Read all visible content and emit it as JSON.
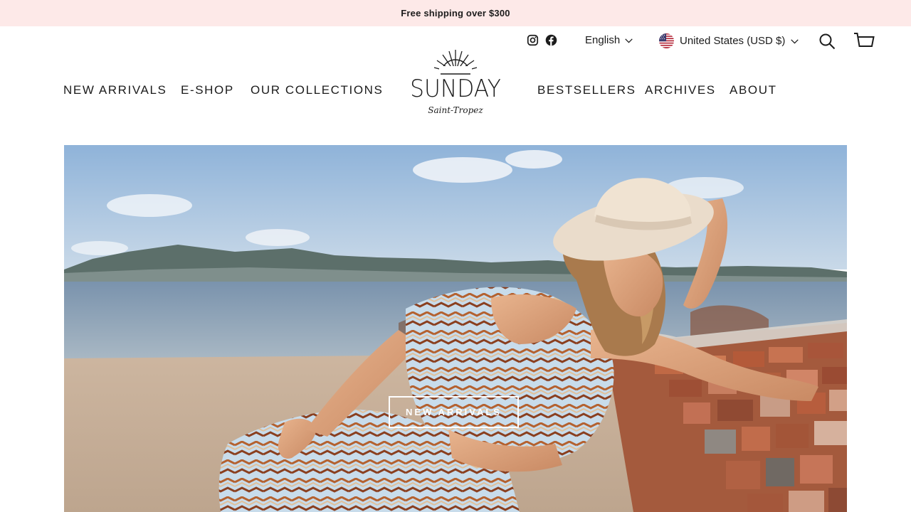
{
  "announcement": {
    "text": "Free shipping over $300"
  },
  "utility": {
    "language": "English",
    "country": "United States (USD $)",
    "social": [
      "instagram-icon",
      "facebook-icon"
    ]
  },
  "nav": {
    "left": [
      "NEW ARRIVALS",
      "E-SHOP",
      "OUR COLLECTIONS"
    ],
    "right": [
      "BESTSELLERS",
      "ARCHIVES",
      "ABOUT"
    ]
  },
  "logo": {
    "wordmark": "SUNDAY",
    "subtitle": "Saint-Tropez"
  },
  "hero": {
    "cta_label": "NEW ARRIVALS"
  },
  "icons": {
    "search": "search-icon",
    "cart": "cart-icon"
  },
  "colors": {
    "announcement_bg": "#fde9e8",
    "text": "#1c1c1c",
    "accent": "#ffffff"
  }
}
